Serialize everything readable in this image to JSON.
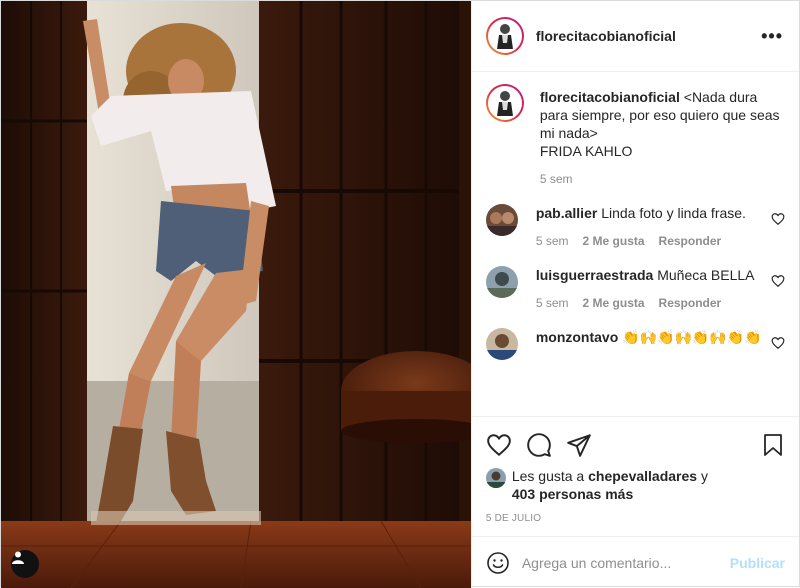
{
  "post": {
    "username": "florecitacobianoficial",
    "more_icon": "more-horizontal-icon",
    "caption": {
      "username": "florecitacobianoficial",
      "text": "<Nada dura para siempre, por eso quiero que seas mi nada>\nFRIDA KAHLO",
      "time": "5 sem"
    },
    "comments": [
      {
        "username": "pab.allier",
        "text": "Linda foto y linda frase.",
        "time": "5 sem",
        "likes": "2 Me gusta",
        "reply": "Responder"
      },
      {
        "username": "luisguerraestrada",
        "text": "Muñeca BELLA",
        "time": "5 sem",
        "likes": "2 Me gusta",
        "reply": "Responder"
      },
      {
        "username": "monzontavo",
        "text": "👏🙌👏🙌👏🙌👏👏",
        "time": "",
        "likes": "",
        "reply": ""
      }
    ],
    "likes": {
      "prefix": "Les gusta a ",
      "user": "chepevalladares",
      "suffix": " y",
      "others": "403 personas más"
    },
    "date": "5 DE JULIO",
    "add_comment": {
      "placeholder": "Agrega un comentario...",
      "publish_label": "Publicar"
    },
    "colors": {
      "text": "#262626",
      "secondary": "#8e8e8e",
      "publish_disabled": "#b2dffc"
    }
  }
}
